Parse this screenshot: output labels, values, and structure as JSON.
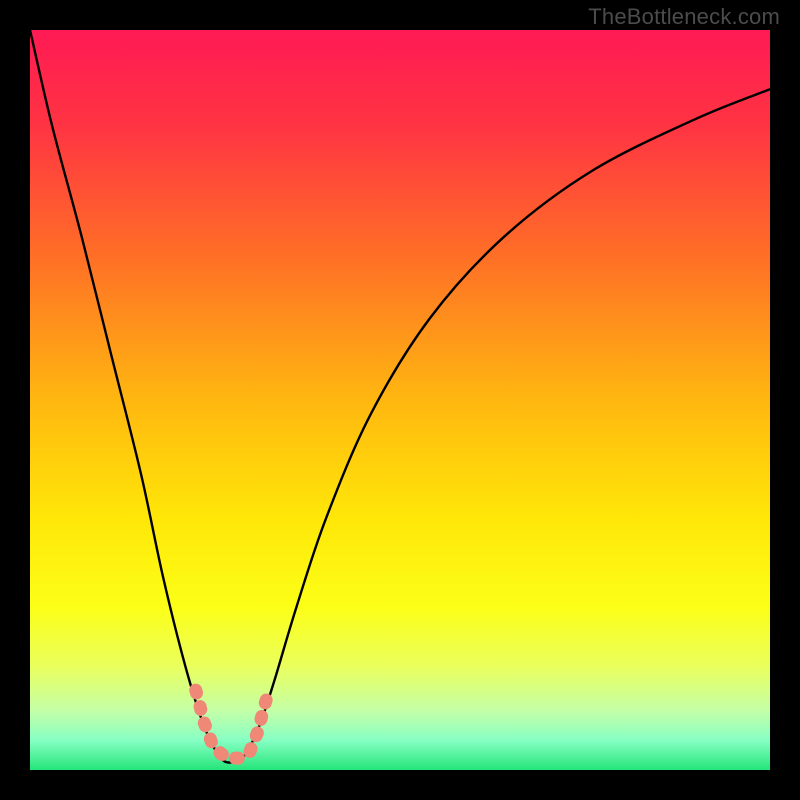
{
  "watermark": "TheBottleneck.com",
  "chart_data": {
    "type": "line",
    "title": "",
    "xlabel": "",
    "ylabel": "",
    "xlim": [
      0,
      100
    ],
    "ylim": [
      0,
      100
    ],
    "grid": false,
    "legend": false,
    "gradient_stops": [
      {
        "pos": 0.0,
        "color": "#ff1a54"
      },
      {
        "pos": 0.13,
        "color": "#ff3443"
      },
      {
        "pos": 0.3,
        "color": "#ff6d27"
      },
      {
        "pos": 0.5,
        "color": "#ffb710"
      },
      {
        "pos": 0.66,
        "color": "#ffe708"
      },
      {
        "pos": 0.78,
        "color": "#fcff17"
      },
      {
        "pos": 0.86,
        "color": "#eaff5d"
      },
      {
        "pos": 0.92,
        "color": "#c4ffa8"
      },
      {
        "pos": 0.96,
        "color": "#86ffc3"
      },
      {
        "pos": 1.0,
        "color": "#24e57a"
      }
    ],
    "series": [
      {
        "name": "bottleneck-curve",
        "color": "#000000",
        "x": [
          0,
          3,
          7,
          11,
          15,
          18,
          21,
          23.5,
          25.5,
          27,
          29,
          31,
          33,
          36,
          40,
          46,
          54,
          64,
          76,
          90,
          100
        ],
        "y": [
          100,
          87,
          72,
          56,
          40,
          26,
          14,
          6,
          2,
          1,
          2,
          6,
          12,
          22,
          34,
          48,
          61,
          72,
          81,
          88,
          92
        ]
      }
    ],
    "markers": {
      "name": "highlight-beads",
      "color": "#f08878",
      "points": [
        {
          "x": 22.4,
          "y": 10.8
        },
        {
          "x": 22.9,
          "y": 8.9
        },
        {
          "x": 23.5,
          "y": 6.5
        },
        {
          "x": 24.6,
          "y": 3.6
        },
        {
          "x": 25.8,
          "y": 2.2
        },
        {
          "x": 27.0,
          "y": 1.6
        },
        {
          "x": 28.2,
          "y": 1.6
        },
        {
          "x": 29.6,
          "y": 2.2
        },
        {
          "x": 30.8,
          "y": 5.2
        },
        {
          "x": 31.6,
          "y": 8.4
        },
        {
          "x": 32.2,
          "y": 10.4
        }
      ]
    }
  }
}
